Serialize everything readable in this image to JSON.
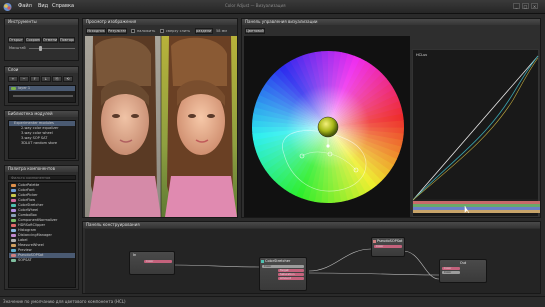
{
  "window": {
    "title": "Color Adjust — Визуализация"
  },
  "menu": [
    "Файл",
    "Вид",
    "Справка"
  ],
  "winbtns": [
    "_",
    "□",
    "×"
  ],
  "left": {
    "panel1": {
      "title": "Инструменты",
      "btns": [
        "Открыть",
        "Сохранить",
        "Отменить",
        "Повторить"
      ],
      "label": "Масштаб"
    },
    "panel2": {
      "title": "Слои",
      "btn_labels": [
        "+",
        "−",
        "↑",
        "↓",
        "⎘",
        "⟲"
      ],
      "layer": "layer 1"
    },
    "panel3": {
      "title": "Библиотека модулей",
      "items": [
        "Experimenter modules",
        "2-way color equalizer",
        "3-way color wheel",
        "3-way SOP SAT",
        "3DLUT random store"
      ]
    },
    "panel4": {
      "title": "Палитра компонентов",
      "search_placeholder": "Фильтр компонентов",
      "items": [
        {
          "label": "ColorPalette",
          "color": "#e0904a"
        },
        {
          "label": "ColorFont",
          "color": "#6fa0d8"
        },
        {
          "label": "ColorPicker",
          "color": "#c9c94a"
        },
        {
          "label": "ColorFlow",
          "color": "#d66aa0"
        },
        {
          "label": "ColorStretcher",
          "color": "#4ec0b0"
        },
        {
          "label": "ColorWheel",
          "color": "#b58ee0"
        },
        {
          "label": "ComboBox",
          "color": "#8aa0b8"
        },
        {
          "label": "ComponentNormalizer",
          "color": "#7cc06a"
        },
        {
          "label": "HDRSoftClipper",
          "color": "#e06a6a"
        },
        {
          "label": "Histogram",
          "color": "#8ab8e0"
        },
        {
          "label": "DistancingManager",
          "color": "#c08ad0"
        },
        {
          "label": "Label",
          "color": "#b0b0b0"
        },
        {
          "label": "MeasureWheel",
          "color": "#d0a060"
        },
        {
          "label": "Preview",
          "color": "#60b0d0"
        },
        {
          "label": "PseudoSOPSat",
          "color": "#d08080"
        },
        {
          "label": "SOPSAT",
          "color": "#80c0a0"
        }
      ]
    }
  },
  "preview": {
    "title": "Просмотр изображения",
    "toolbar": [
      "Исходник",
      "Результат"
    ],
    "checks": [
      "наложить",
      "сверху слить",
      "разделить"
    ],
    "zoom": "100%",
    "zoom_unit": "58 мм"
  },
  "wheel": {
    "title": "Панель управления визуализации",
    "tab": "Цветовой",
    "graph_label": "HCLuv"
  },
  "nodes": {
    "title": "Панель конструирования",
    "in": {
      "title": "In",
      "ports": [
        "Color"
      ]
    },
    "stretcher": {
      "title": "ColorStretcher",
      "ports": [
        "Color",
        "Target",
        "Saturation",
        "Amount"
      ]
    },
    "pseudo": {
      "title": "PseudoSOPSat",
      "ports": [
        "Color"
      ]
    },
    "out": {
      "title": "Out",
      "ports": [
        "Color",
        "Color"
      ]
    }
  },
  "status": "Значение по умолчанию для цветового компонента (HCL)"
}
